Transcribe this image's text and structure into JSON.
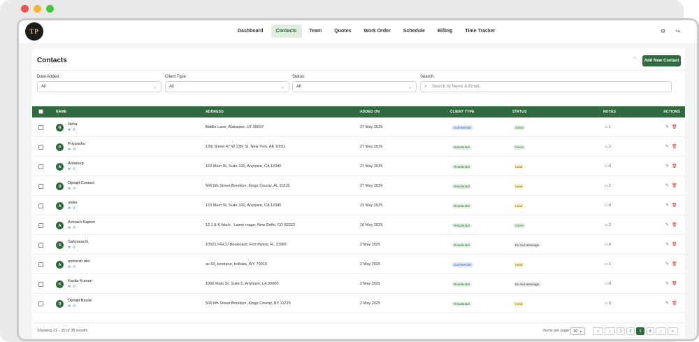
{
  "nav": {
    "logo_text": "TP",
    "items": [
      {
        "label": "Dashboard",
        "active": false
      },
      {
        "label": "Contacts",
        "active": true
      },
      {
        "label": "Team",
        "active": false
      },
      {
        "label": "Quotes",
        "active": false
      },
      {
        "label": "Work Order",
        "active": false
      },
      {
        "label": "Schedule",
        "active": false
      },
      {
        "label": "Billing",
        "active": false
      },
      {
        "label": "Time Tracker",
        "active": false
      }
    ],
    "icons": [
      "settings-icon",
      "logout-icon"
    ]
  },
  "page": {
    "title": "Contacts",
    "add_button": "Add New Contact"
  },
  "filters": {
    "date_added": {
      "label": "Date Added",
      "value": "All"
    },
    "client_type": {
      "label": "Client Type",
      "value": "All"
    },
    "status": {
      "label": "Status",
      "value": "All"
    },
    "search": {
      "label": "Search",
      "placeholder": "Search by Name & Email..."
    }
  },
  "table": {
    "headers": {
      "name": "NAME",
      "address": "ADDRESS",
      "added_on": "ADDED ON",
      "client_type": "CLIENT TYPE",
      "status": "STATUS",
      "notes": "NOTES",
      "actions": "ACTIONS"
    },
    "rows": [
      {
        "initial": "N",
        "name": "Neha",
        "address": "Biddle Lane, Alabaster, UT 35007",
        "added_on": "27 May 2025",
        "client_type": "Commercial",
        "status": "Client",
        "notes": "1"
      },
      {
        "initial": "P",
        "name": "Priyanshu",
        "address": "13th Street 47 W 13th St, New York, AK 10011",
        "added_on": "27 May 2025",
        "client_type": "Residential",
        "status": "Client",
        "notes": "2"
      },
      {
        "initial": "A",
        "name": "Antareep",
        "address": "123 Main St, Suite 100, Anytown, CA 12345",
        "added_on": "27 May 2025",
        "client_type": "Residential",
        "status": "Lead",
        "notes": "0"
      },
      {
        "initial": "D",
        "name": "Diptajit Contact",
        "address": "506 6th Street Brooklyn, Kings County, AL 11215",
        "added_on": "27 May 2025",
        "client_type": "Residential",
        "status": "Lead",
        "notes": "2"
      },
      {
        "initial": "A",
        "name": "anika",
        "address": "123 Main St, Suite 100, Anytown, CA 12345",
        "added_on": "23 May 2025",
        "client_type": "Residential",
        "status": "Lead",
        "notes": "0"
      },
      {
        "initial": "A",
        "name": "Avinash Kapoor",
        "address": "12 J & K block , Laxmi nagar, New Delhi, CO 92222",
        "added_on": "16 May 2025",
        "client_type": "Residential",
        "status": "Client",
        "notes": "2"
      },
      {
        "initial": "S",
        "name": "Sabyasachi",
        "address": "10501 FGCU Boulevard, Fort Myers, FL 33965",
        "added_on": "2 May 2025",
        "client_type": "Residential",
        "status": "Do Not Message",
        "notes": "4"
      },
      {
        "initial": "A",
        "name": "animesh dev",
        "address": "ac 60, kestopur, kolkata, WY 70010",
        "added_on": "2 May 2025",
        "client_type": "Commercial",
        "status": "Lead",
        "notes": "1"
      },
      {
        "initial": "K",
        "name": "Kavita Kumari",
        "address": "1000 Main St, Suite 0, Anytown, LA 90000",
        "added_on": "2 May 2025",
        "client_type": "Residential",
        "status": "Do Not Message",
        "notes": "0"
      },
      {
        "initial": "D",
        "name": "Diptajit Basak",
        "address": "506 6th Street Brooklyn, Kings County, NY 11215",
        "added_on": "2 May 2025",
        "client_type": "Residential",
        "status": "Lead",
        "notes": "0"
      }
    ]
  },
  "footer": {
    "showing": "Showing 21 - 30 of 38 results",
    "items_per_page_label": "Items per page:",
    "items_per_page": "10",
    "pages": [
      "«",
      "‹",
      "1",
      "2",
      "3",
      "4",
      "›",
      "»"
    ],
    "current_page": "3"
  },
  "colors": {
    "brand": "#2f6b3f",
    "active_nav": "#dfeedd"
  }
}
